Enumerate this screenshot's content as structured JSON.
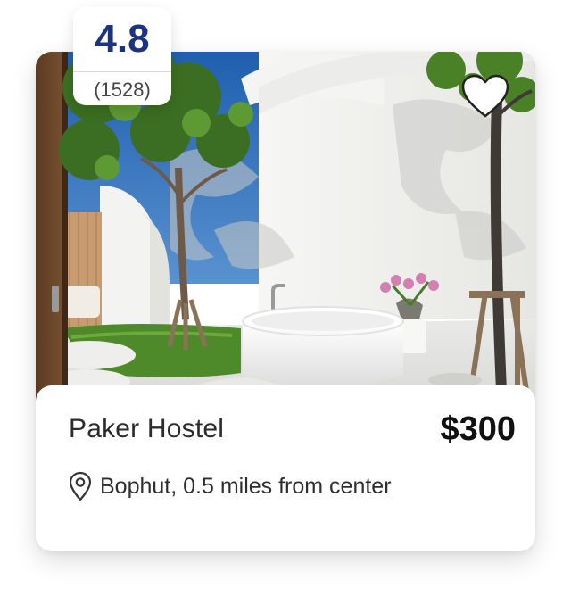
{
  "rating": {
    "score": "4.8",
    "count": "(1528)"
  },
  "listing": {
    "name": "Paker Hostel",
    "price": "$300",
    "location": "Bophut, 0.5 miles from center",
    "favorited": false
  },
  "icons": {
    "favorite": "heart-icon",
    "location": "map-pin-icon"
  },
  "colors": {
    "rating_score": "#1c3480",
    "sky": "#2f6fb6",
    "wall": "#f2f2f0",
    "grass": "#4f8a2a"
  }
}
